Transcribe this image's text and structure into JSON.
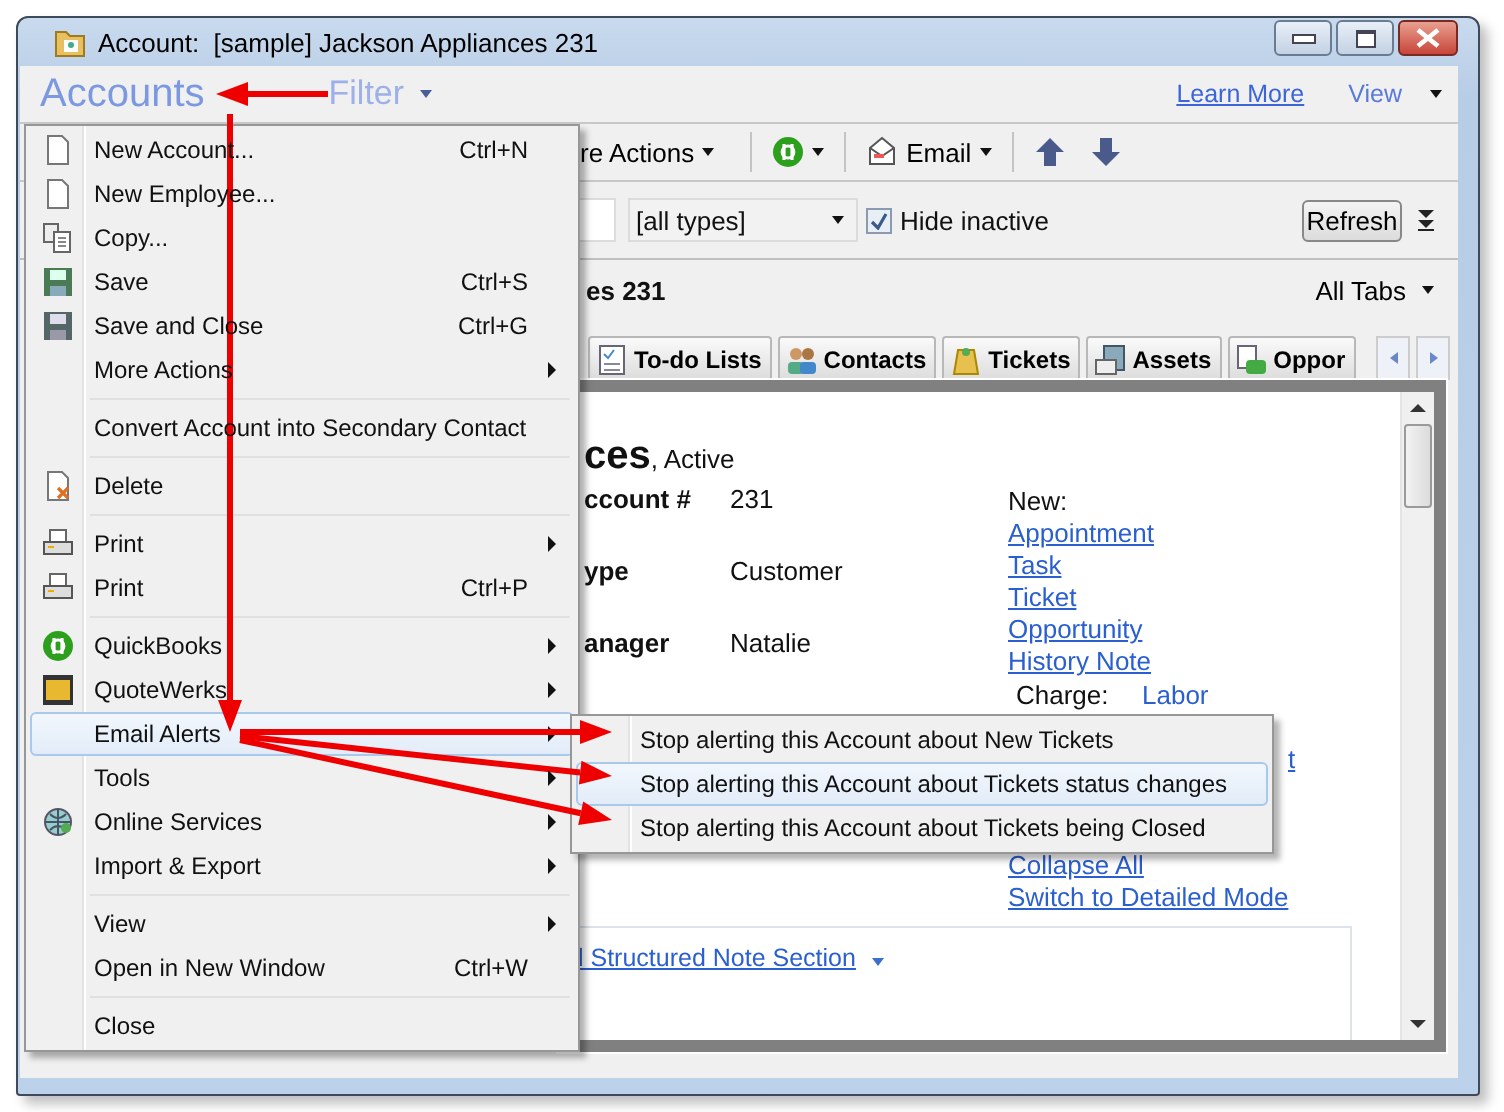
{
  "window": {
    "title": "Account:  [sample] Jackson Appliances 231"
  },
  "header": {
    "title": "Accounts",
    "filter": "Filter",
    "learn_more": "Learn More",
    "view": "View"
  },
  "toolbar": {
    "more_actions": "re Actions",
    "email": "Email"
  },
  "filter_bar": {
    "type_select": "[all types]",
    "hide_inactive": {
      "label": "Hide inactive",
      "checked": true
    },
    "refresh": "Refresh"
  },
  "record_bar": {
    "title": "es 231",
    "all_tabs": "All Tabs"
  },
  "tabs": [
    {
      "label": "To-do Lists",
      "selected": false
    },
    {
      "label": "Contacts",
      "selected": false
    },
    {
      "label": "Tickets",
      "selected": false
    },
    {
      "label": "Assets",
      "selected": false
    },
    {
      "label": "Oppor",
      "selected": false
    }
  ],
  "details": {
    "name": "ces",
    "status": ", Active",
    "fields": [
      {
        "label": "ccount #",
        "value": "231"
      },
      {
        "label": "ype",
        "value": "Customer"
      },
      {
        "label": "anager",
        "value": "Natalie"
      }
    ],
    "new_label": "New:",
    "new_links": [
      "Appointment",
      "Task",
      "Ticket",
      "Opportunity",
      "History Note"
    ],
    "charge_label": "Charge:",
    "charge_value": "Labor",
    "partial_link": "t",
    "links": [
      "Collapse All",
      "Switch to Detailed Mode"
    ],
    "note_section": "l Structured Note Section"
  },
  "menu": {
    "items": [
      {
        "kind": "item",
        "label": "New Account...",
        "shortcut": "Ctrl+N",
        "submenu": false,
        "selected": false
      },
      {
        "kind": "item",
        "label": "New Employee...",
        "submenu": false,
        "selected": false
      },
      {
        "kind": "item",
        "label": "Copy...",
        "submenu": false,
        "selected": false
      },
      {
        "kind": "item",
        "label": "Save",
        "shortcut": "Ctrl+S",
        "submenu": false,
        "selected": false
      },
      {
        "kind": "item",
        "label": "Save and Close",
        "shortcut": "Ctrl+G",
        "submenu": false,
        "selected": false
      },
      {
        "kind": "item",
        "label": "More Actions",
        "submenu": true,
        "selected": false
      },
      {
        "kind": "separator"
      },
      {
        "kind": "item",
        "label": "Convert Account into Secondary Contact",
        "submenu": false,
        "selected": false
      },
      {
        "kind": "separator"
      },
      {
        "kind": "item",
        "label": "Delete",
        "submenu": false,
        "selected": false
      },
      {
        "kind": "separator"
      },
      {
        "kind": "item",
        "label": "Print",
        "submenu": true,
        "selected": false
      },
      {
        "kind": "item",
        "label": "Print",
        "shortcut": "Ctrl+P",
        "submenu": false,
        "selected": false
      },
      {
        "kind": "separator"
      },
      {
        "kind": "item",
        "label": "QuickBooks",
        "submenu": true,
        "selected": false
      },
      {
        "kind": "item",
        "label": "QuoteWerks",
        "submenu": true,
        "selected": false
      },
      {
        "kind": "item",
        "label": "Email Alerts",
        "submenu": true,
        "selected": true
      },
      {
        "kind": "item",
        "label": "Tools",
        "submenu": true,
        "selected": false
      },
      {
        "kind": "item",
        "label": "Online Services",
        "submenu": true,
        "selected": false
      },
      {
        "kind": "item",
        "label": "Import & Export",
        "submenu": true,
        "selected": false
      },
      {
        "kind": "separator"
      },
      {
        "kind": "item",
        "label": "View",
        "submenu": true,
        "selected": false
      },
      {
        "kind": "item",
        "label": "Open in New Window",
        "shortcut": "Ctrl+W",
        "submenu": false,
        "selected": false
      },
      {
        "kind": "separator"
      },
      {
        "kind": "item",
        "label": "Close",
        "submenu": false,
        "selected": false
      }
    ]
  },
  "submenu": {
    "items": [
      {
        "label": "Stop alerting this Account about New Tickets",
        "selected": false
      },
      {
        "label": "Stop alerting this Account about Tickets status changes",
        "selected": true
      },
      {
        "label": "Stop alerting this Account about Tickets being Closed",
        "selected": false
      }
    ]
  }
}
